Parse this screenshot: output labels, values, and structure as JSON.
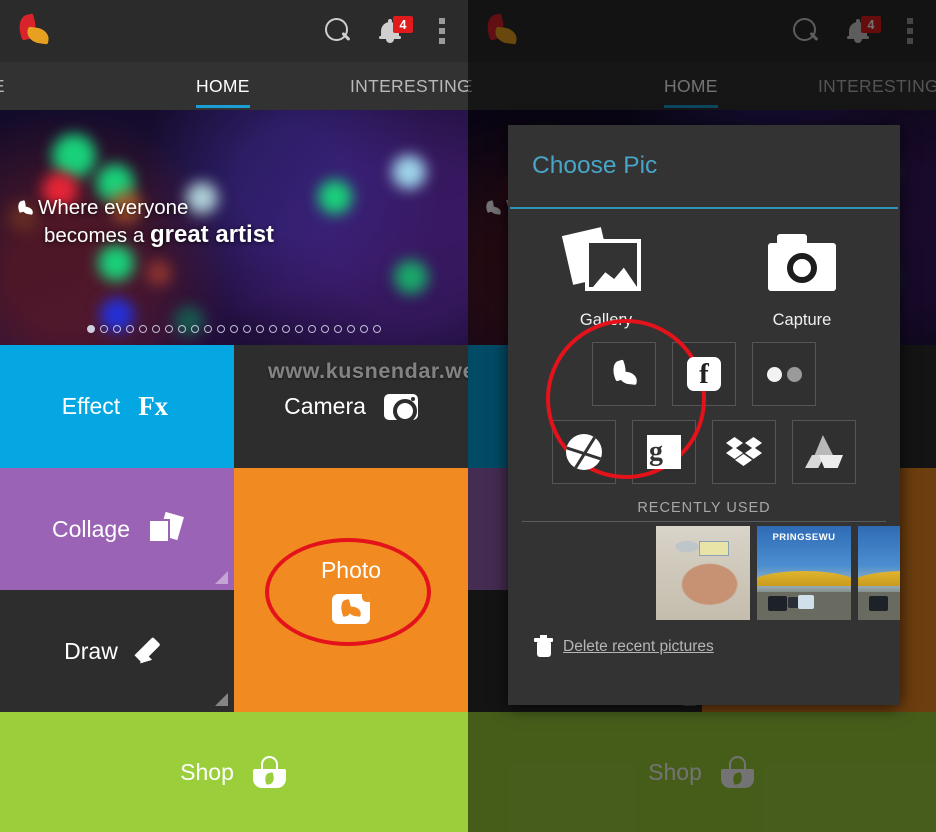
{
  "appbar": {
    "logo_icon": "picsart-logo-icon",
    "search_icon": "search-icon",
    "notifications_icon": "bell-icon",
    "notification_count": "4",
    "overflow_icon": "overflow-menu-icon"
  },
  "tabs": [
    {
      "label": "ME",
      "active": false
    },
    {
      "label": "HOME",
      "active": true
    },
    {
      "label": "INTERESTING",
      "active": false
    }
  ],
  "banner": {
    "line1": "Where everyone",
    "line2_prefix": "becomes a ",
    "line2_strong": "great artist",
    "dot_count": 23,
    "active_dot": 1
  },
  "tiles": [
    {
      "label": "Effect",
      "icon": "effects-fx-icon",
      "color": "#05a7e3"
    },
    {
      "label": "Camera",
      "icon": "camera-icon",
      "color": "#2d2d2d"
    },
    {
      "label": "Collage",
      "icon": "collage-icon",
      "color": "#9a63b5"
    },
    {
      "label": "Photo",
      "icon": "picsart-photo-icon",
      "color": "#f18a21"
    },
    {
      "label": "Draw",
      "icon": "pencil-icon",
      "color": "#2d2d2d"
    },
    {
      "label": "Shop",
      "icon": "shopping-bag-icon",
      "color": "#9bce3b"
    }
  ],
  "watermark": "www.kusnendar.web.id",
  "annotations": {
    "photo_highlight_color": "#e4121b",
    "gallery_highlight_color": "#e4121b"
  },
  "dialog": {
    "title": "Choose Pic",
    "accent_color": "#2d93b4",
    "title_color": "#48a5c8",
    "primary_options": [
      {
        "label": "Gallery",
        "icon": "gallery-icon",
        "highlighted": true
      },
      {
        "label": "Capture",
        "icon": "camera-capture-icon",
        "highlighted": false
      }
    ],
    "services_row1": [
      {
        "name": "PicsArt",
        "icon": "picsart-icon"
      },
      {
        "name": "Facebook",
        "icon": "facebook-icon",
        "glyph": "f"
      },
      {
        "name": "Flickr",
        "icon": "flickr-icon"
      }
    ],
    "services_row2": [
      {
        "name": "Picasa",
        "icon": "picasa-icon"
      },
      {
        "name": "Google+",
        "icon": "google-plus-icon",
        "glyph": "g"
      },
      {
        "name": "Dropbox",
        "icon": "dropbox-icon"
      },
      {
        "name": "Google Drive",
        "icon": "google-drive-icon"
      }
    ],
    "recent_header": "RECENTLY USED",
    "recent_thumbs": [
      {
        "name": "hand-photo-thumbnail",
        "caption": ""
      },
      {
        "name": "pringsewu-arch-thumbnail",
        "caption": "PRINGSEWU"
      },
      {
        "name": "pringsewu-arch-thumbnail-2",
        "caption": ""
      }
    ],
    "delete_label": "Delete recent pictures",
    "delete_icon": "trash-icon"
  }
}
